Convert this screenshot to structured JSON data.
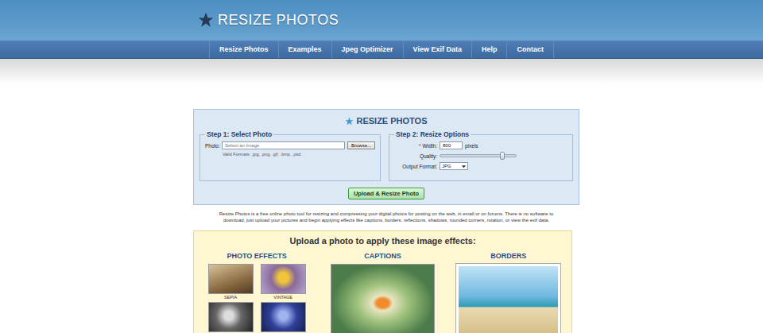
{
  "header": {
    "logo": "RESIZE PHOTOS"
  },
  "nav": [
    {
      "label": "Resize Photos"
    },
    {
      "label": "Examples"
    },
    {
      "label": "Jpeg Optimizer"
    },
    {
      "label": "View Exif Data"
    },
    {
      "label": "Help"
    },
    {
      "label": "Contact"
    }
  ],
  "upload_panel": {
    "title": "RESIZE PHOTOS",
    "step1": {
      "legend": "Step 1: Select Photo",
      "label": "Photo:",
      "placeholder": "Select an Image",
      "browse": "Browse...",
      "formats": "Valid Formats: .jpg, .png, .gif, .bmp, .psd"
    },
    "step2": {
      "legend": "Step 2: Resize Options",
      "required": "*",
      "width_label": "Width:",
      "width_value": "800",
      "width_unit": "pixels",
      "quality_label": "Quality:",
      "quality_level": 0.82,
      "format_label": "Output Format:",
      "format_value": "JPG"
    },
    "submit": "Upload & Resize Photo"
  },
  "description": "Resize Photos is a free online photo tool for resizing and compressing your digital photos for posting on the web, in email or on forums. There is no software to download, just upload your pictures and begin applying effects like captions, borders, reflections, shadows, rounded corners, rotation, or view the exif data.",
  "effects": {
    "title": "Upload a photo to apply these image effects:",
    "columns": [
      {
        "heading": "PHOTO EFFECTS",
        "kind": "thumbs",
        "thumbs": [
          {
            "label": "SEPIA"
          },
          {
            "label": "VINTAGE"
          },
          {
            "label": ""
          },
          {
            "label": ""
          }
        ]
      },
      {
        "heading": "CAPTIONS",
        "kind": "captions"
      },
      {
        "heading": "BORDERS",
        "kind": "borders"
      }
    ]
  }
}
